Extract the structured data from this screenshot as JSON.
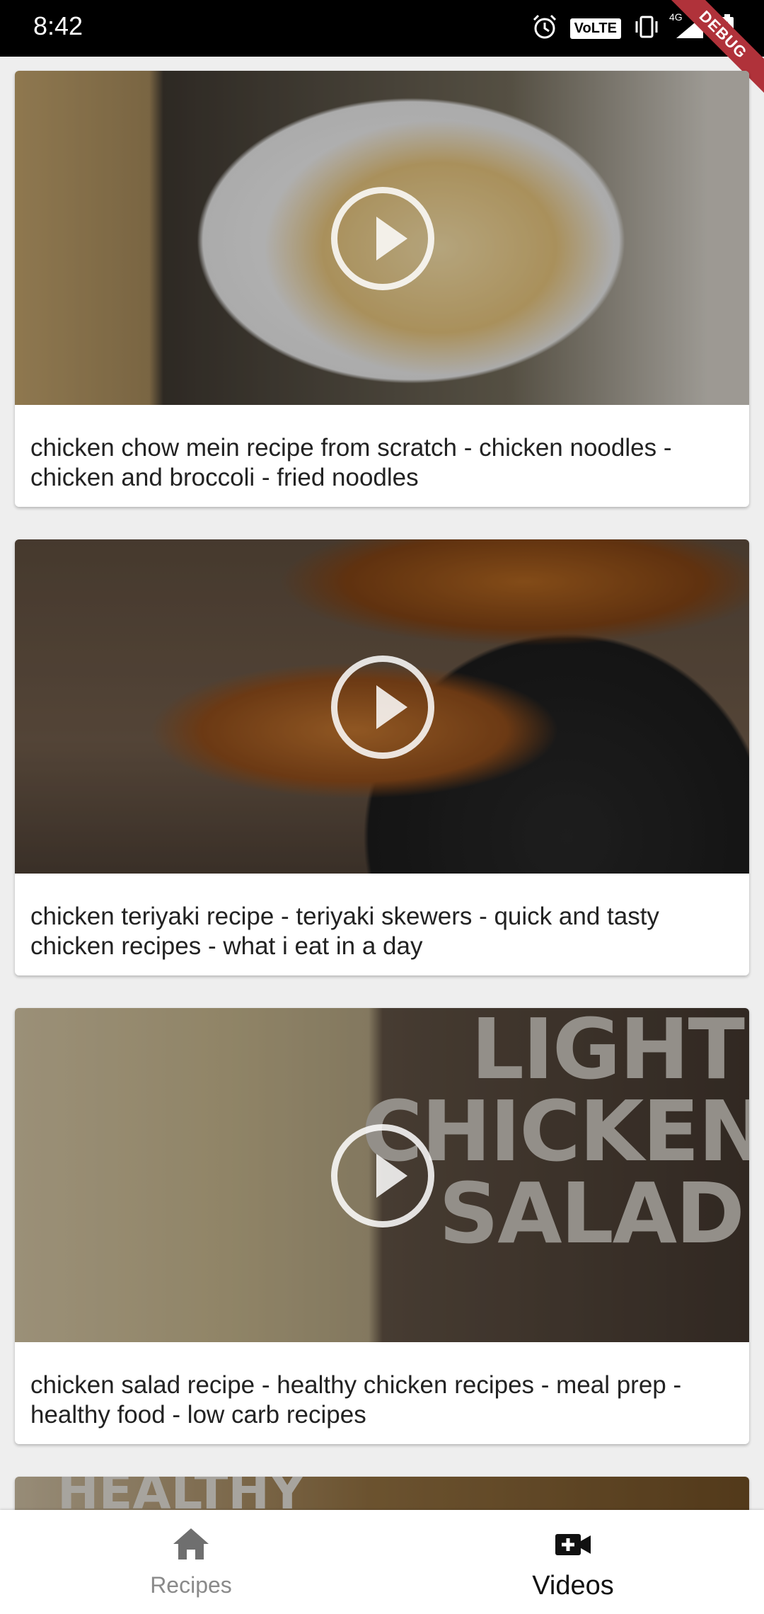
{
  "status_bar": {
    "time": "8:42",
    "volte": "VoLTE",
    "network": "4G",
    "debug_banner": "DEBUG",
    "icons": [
      "alarm-icon",
      "vibrate-icon",
      "signal-icon",
      "battery-charging-icon"
    ]
  },
  "videos": [
    {
      "title": "chicken chow mein recipe from scratch - chicken noodles - chicken and broccoli - fried noodles"
    },
    {
      "title": "chicken teriyaki recipe - teriyaki skewers - quick and tasty chicken recipes - what i eat in a day"
    },
    {
      "title": "chicken salad recipe - healthy chicken recipes - meal prep - healthy food - low carb recipes",
      "thumbnail_text": [
        "LIGHT",
        "CHICKEN",
        "SALAD"
      ]
    },
    {
      "title": "",
      "thumbnail_text": [
        "HEALTHY"
      ]
    }
  ],
  "bottom_nav": {
    "items": [
      {
        "label": "Recipes",
        "icon": "home-icon",
        "selected": false
      },
      {
        "label": "Videos",
        "icon": "video-add-icon",
        "selected": true
      }
    ]
  },
  "colors": {
    "card_bg": "#ffffff",
    "feed_bg": "#eeeeee",
    "status_bar": "#000000",
    "nav_selected": "#111111",
    "nav_unselected": "#8a8a8a",
    "debug_ribbon": "#b0323a"
  }
}
